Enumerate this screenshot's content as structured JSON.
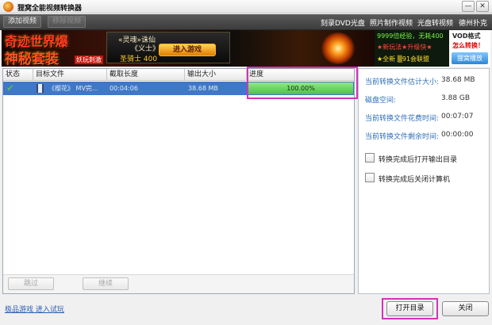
{
  "window": {
    "title": "狸窝全能视频转换器",
    "min_symbol": "—",
    "close_symbol": "✕"
  },
  "toolbar": {
    "add_video": "添加视频",
    "remove_video": "移除视频",
    "links": [
      "刻录DVD光盘",
      "照片制作视频",
      "光盘转视频",
      "德州扑克"
    ]
  },
  "ad": {
    "line1": "奇迹世界爆",
    "line2": "神秘套装",
    "tag": "妖玩刺激",
    "panel_line1": "«灵魂»诛仙",
    "panel_line2": "《义士》",
    "panel_line3": "圣骑士 400",
    "play_button": "进入游戏",
    "mid_line1": "9999倍经验，无耗400",
    "mid_line2": "★新玩法★升级快★",
    "mid_line3": "★全新 ▒91会联盟",
    "right_line1": "VOD格式",
    "right_line2": "怎么转换！",
    "right_line3": "狸窝播放"
  },
  "list": {
    "columns": [
      "状态",
      "目标文件",
      "截取长度",
      "输出大小",
      "进度"
    ],
    "rows": [
      {
        "status_icon": "check-icon",
        "file": "《樱花》 MV完…",
        "duration": "00:04:06",
        "size": "38.68 MB",
        "progress_percent": 100,
        "progress_text": "100.00%"
      }
    ],
    "skip_button": "跳过",
    "continue_button": "继续"
  },
  "info": {
    "estimated_size_label": "当前转换文件估计大小:",
    "estimated_size_value": "38.68 MB",
    "disk_space_label": "磁盘空间:",
    "disk_space_value": "3.88 GB",
    "time_spent_label": "当前转换文件花费时间:",
    "time_spent_value": "00:07:07",
    "time_left_label": "当前转换文件剩余时间:",
    "time_left_value": "00:00:00",
    "open_dir_option": "转换完成后打开输出目录",
    "shutdown_option": "转换完成后关闭计算机"
  },
  "footer": {
    "link": "极品游戏 进入试玩",
    "open_dir_button": "打开目录",
    "close_button": "关闭"
  },
  "colors": {
    "selection": "#3f77c9",
    "progress_green": "#4fc04a",
    "highlight_magenta": "#d433b8",
    "info_label_blue": "#2f6fb8"
  }
}
